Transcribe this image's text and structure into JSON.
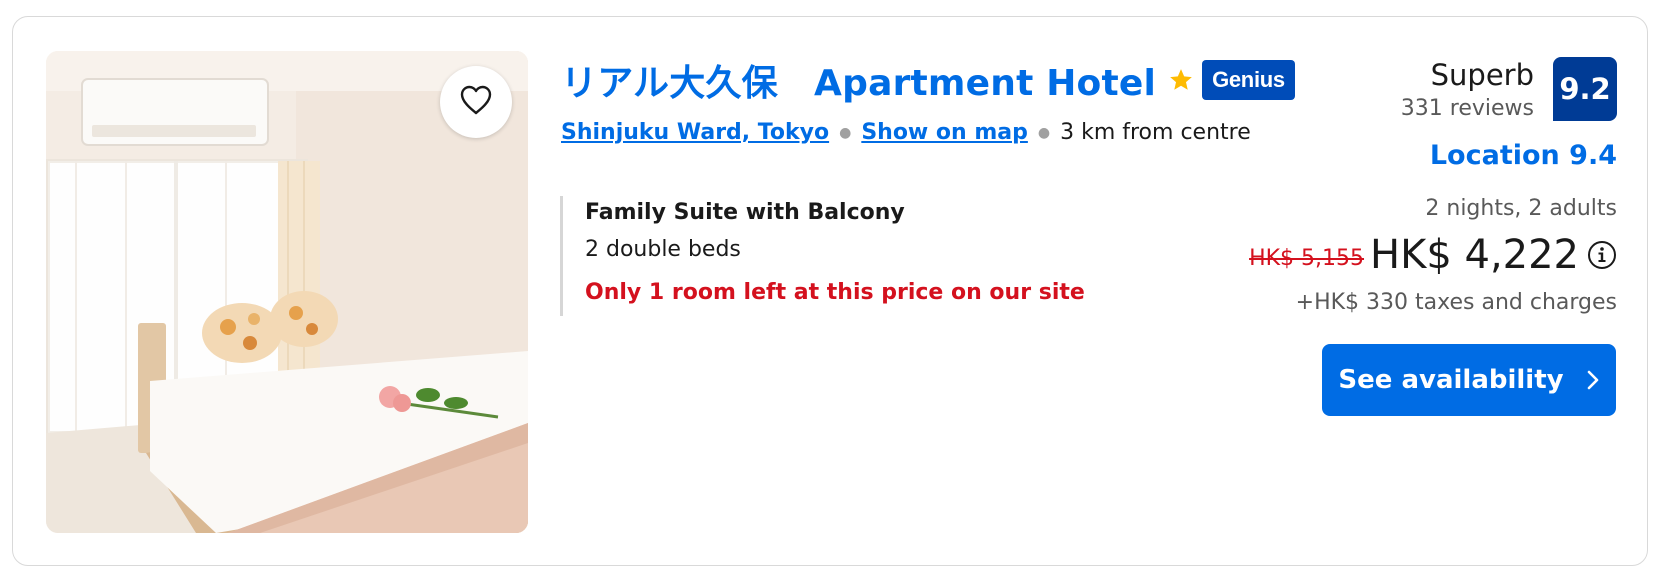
{
  "hotel": {
    "name": "リアル大久保　Apartment Hotel",
    "genius_label": "Genius",
    "location_link": "Shinjuku Ward, Tokyo",
    "map_link": "Show on map",
    "distance": "3 km from centre"
  },
  "room": {
    "name": "Family Suite with Balcony",
    "beds": "2 double beds",
    "scarcity": "Only 1 room left at this price on our site"
  },
  "rating": {
    "word": "Superb",
    "reviews": "331 reviews",
    "score": "9.2",
    "location": "Location 9.4"
  },
  "pricing": {
    "stay": "2 nights, 2 adults",
    "original": "HK$ 5,155",
    "current": "HK$ 4,222",
    "taxes": "+HK$ 330 taxes and charges"
  },
  "cta": {
    "label": "See availability"
  },
  "icons": {
    "wishlist": "heart-icon",
    "star": "star-icon",
    "info": "info-icon",
    "cta_arrow": "chevron-right-icon"
  },
  "colors": {
    "link": "#006ce4",
    "score_bg": "#003b95",
    "genius_bg": "#004cb8",
    "alert": "#d4111e",
    "star": "#febb02"
  }
}
